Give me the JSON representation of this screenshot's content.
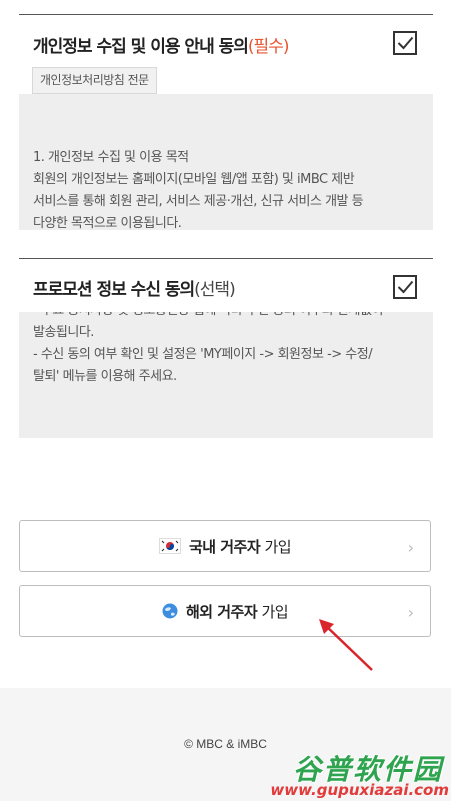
{
  "privacy": {
    "title": "개인정보 수집 및 이용 안내 동의",
    "required": "(필수)",
    "policy_button": "개인정보처리방침 전문",
    "lines": [
      "1. 개인정보 수집 및 이용 목적",
      "회원의 개인정보는 홈페이지(모바일 웹/앱 포함) 및 iMBC 제반",
      "서비스를 통해 회원 관리, 서비스 제공·개선, 신규 서비스 개발 등",
      "다양한 목적으로 이용됩니다."
    ],
    "checked": true
  },
  "promotion": {
    "title": "프로모션 정보 수신 동의",
    "optional": "(선택)",
    "lines": [
      "- 주요 공지사항 및 정보통신망 법에 따라 수신 동의 여부와 관계없이",
      "발송됩니다.",
      "- 수신 동의 여부 확인 및 설정은 'MY페이지 -> 회원정보 -> 수정/",
      "탈퇴' 메뉴를 이용해 주세요."
    ],
    "checked": true
  },
  "buttons": {
    "domestic": {
      "bold": "국내 거주자",
      "rest": " 가입"
    },
    "overseas": {
      "bold": "해외 거주자",
      "rest": " 가입"
    }
  },
  "footer": {
    "copyright": "© MBC & iMBC"
  },
  "watermark": {
    "cn": "谷普软件园",
    "url": "www.gupuxiazai.com"
  },
  "colors": {
    "required": "#e8542e",
    "arrow": "#d9262c",
    "watermark_green": "#2ea44f",
    "watermark_red": "#e23b3b"
  }
}
